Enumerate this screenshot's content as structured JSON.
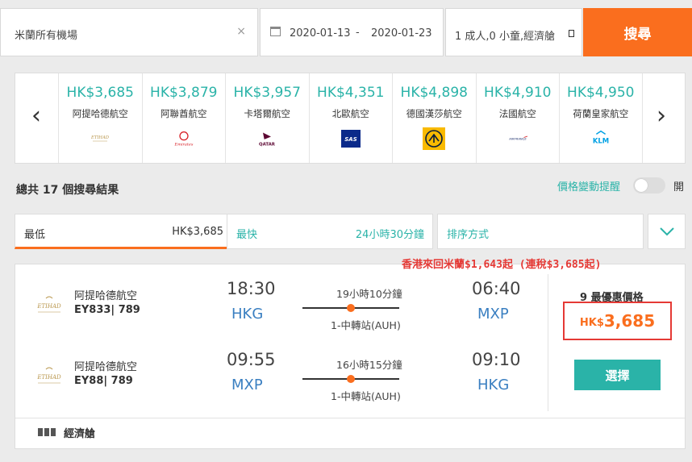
{
  "search": {
    "origin": "米蘭所有機場",
    "depart_date": "2020-01-13",
    "date_separator": "-",
    "return_date": "2020-01-23",
    "passengers": "1 成人,0 小童,經濟艙",
    "search_label": "搜尋"
  },
  "airlines": [
    {
      "price": "HK$3,685",
      "name": "阿提哈德航空",
      "logo": "ETIHAD"
    },
    {
      "price": "HK$3,879",
      "name": "阿聯酋航空",
      "logo": "Emirates"
    },
    {
      "price": "HK$3,957",
      "name": "卡塔爾航空",
      "logo": "QATAR"
    },
    {
      "price": "HK$4,351",
      "name": "北歐航空",
      "logo": "SAS"
    },
    {
      "price": "HK$4,898",
      "name": "德國漢莎航空",
      "logo": "lufthansa-crane-icon"
    },
    {
      "price": "HK$4,910",
      "name": "法國航空",
      "logo": "AIRFRANCE"
    },
    {
      "price": "HK$4,950",
      "name": "荷蘭皇家航空",
      "logo": "KLM"
    }
  ],
  "summary": {
    "total": "總共 17 個搜尋結果",
    "price_alert": "價格變動提醒",
    "toggle_state": "開"
  },
  "tabs": {
    "cheapest_label": "最低",
    "cheapest_value": "HK$3,685",
    "fastest_label": "最快",
    "fastest_value": "24小時30分鐘",
    "sort_label": "排序方式"
  },
  "promo": "香港來回米蘭$1,643起 (連稅$3,685起)",
  "result": {
    "legs": [
      {
        "airline": "阿提哈德航空",
        "flight": "EY833| 789",
        "dep_time": "18:30",
        "dep_code": "HKG",
        "duration": "19小時10分鐘",
        "stops": "1-中轉站(AUH)",
        "arr_time": "06:40",
        "arr_code": "MXP"
      },
      {
        "airline": "阿提哈德航空",
        "flight": "EY88| 789",
        "dep_time": "09:55",
        "dep_code": "MXP",
        "duration": "16小時15分鐘",
        "stops": "1-中轉站(AUH)",
        "arr_time": "09:10",
        "arr_code": "HKG"
      }
    ],
    "deals": "9 最優惠價格",
    "currency": "HK$",
    "amount": "3,685",
    "select_label": "選擇",
    "cabin": "經濟艙"
  },
  "colors": {
    "accent": "#fa6e1e",
    "teal": "#2ab3a8",
    "alert_red": "#e53935"
  }
}
